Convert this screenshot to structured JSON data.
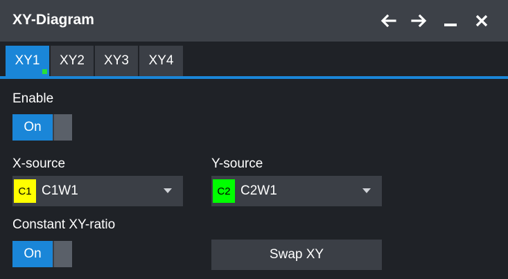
{
  "window": {
    "title": "XY-Diagram",
    "controls": [
      "back-arrow-icon",
      "forward-arrow-icon",
      "minimize-icon",
      "close-icon"
    ]
  },
  "tabs": [
    {
      "label": "XY1",
      "active": true
    },
    {
      "label": "XY2",
      "active": false
    },
    {
      "label": "XY3",
      "active": false
    },
    {
      "label": "XY4",
      "active": false
    }
  ],
  "enable": {
    "label": "Enable",
    "toggle_text": "On"
  },
  "x_source": {
    "label": "X-source",
    "chip": "C1",
    "chip_color": "#ffff00",
    "value": "C1W1"
  },
  "y_source": {
    "label": "Y-source",
    "chip": "C2",
    "chip_color": "#00ff00",
    "value": "C2W1"
  },
  "ratio": {
    "label": "Constant XY-ratio",
    "toggle_text": "On"
  },
  "swap": {
    "label": "Swap XY"
  },
  "colors": {
    "accent": "#1a86d8",
    "titlebar": "#3d4148",
    "indicator": "#27e03a"
  }
}
